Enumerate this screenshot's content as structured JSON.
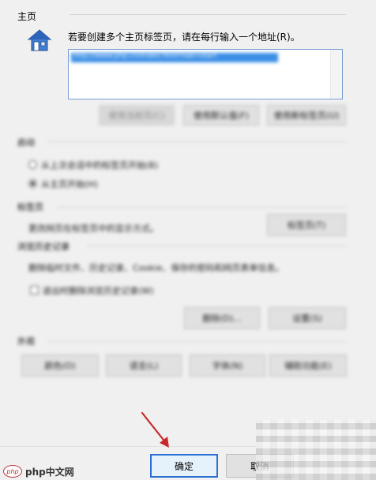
{
  "homepage": {
    "title": "主页",
    "instruction": "若要创建多个主页标签页，请在每行输入一个地址(R)。",
    "address_value": "http://www.php.cn/index.html?tab=start",
    "buttons": [
      "使用当前页(C)",
      "使用默认值(F)",
      "使用新标签页(U)"
    ]
  },
  "startup": {
    "title": "启动",
    "options": [
      "从上次会话中的标签页开始(B)",
      "从主页开始(H)"
    ]
  },
  "tabs": {
    "title": "标签页",
    "description": "更改网页在标签页中的显示方式。",
    "button": "标签页(T)"
  },
  "history": {
    "title": "浏览历史记录",
    "description": "删除临时文件、历史记录、Cookie、保存的密码和网页表单信息。",
    "checkbox": "退出时删除浏览历史记录(W)",
    "buttons": [
      "删除(D)...",
      "设置(S)"
    ]
  },
  "appearance": {
    "title": "外观",
    "buttons": [
      "颜色(O)",
      "语言(L)",
      "字体(N)",
      "辅助功能(E)"
    ]
  },
  "footer": {
    "ok": "确定",
    "cancel": "取消"
  },
  "watermark": {
    "text": "php中文网"
  },
  "colors": {
    "annotation_arrow": "#c8282a",
    "selection": "#3a8ee6",
    "ok_border": "#2a6fd1"
  }
}
